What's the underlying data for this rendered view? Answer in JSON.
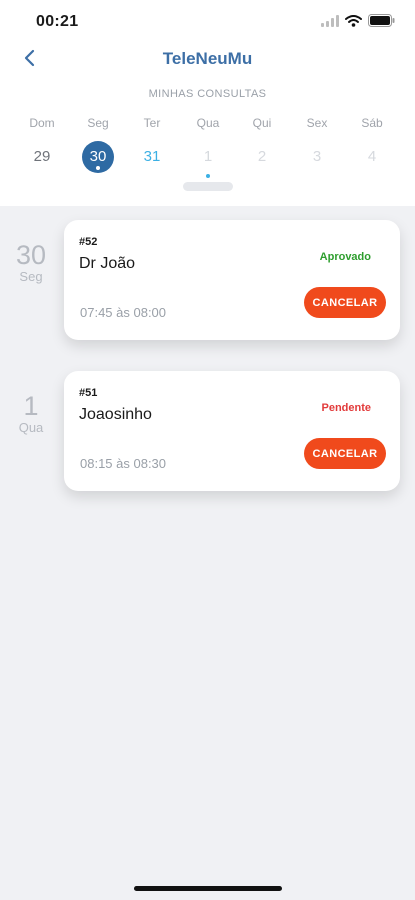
{
  "status_bar": {
    "time": "00:21"
  },
  "header": {
    "title": "TeleNeuMu",
    "subtitle": "MINHAS CONSULTAS"
  },
  "week": [
    {
      "day": "Dom",
      "num": "29"
    },
    {
      "day": "Seg",
      "num": "30"
    },
    {
      "day": "Ter",
      "num": "31"
    },
    {
      "day": "Qua",
      "num": "1"
    },
    {
      "day": "Qui",
      "num": "2"
    },
    {
      "day": "Sex",
      "num": "3"
    },
    {
      "day": "Sáb",
      "num": "4"
    }
  ],
  "appointments": [
    {
      "date_num": "30",
      "date_day": "Seg",
      "code": "#52",
      "name": "Dr João",
      "time": "07:45 às 08:00",
      "status": "Aprovado",
      "status_color": "#2e9e2e",
      "cancel_label": "CANCELAR"
    },
    {
      "date_num": "1",
      "date_day": "Qua",
      "code": "#51",
      "name": "Joaosinho",
      "time": "08:15 às 08:30",
      "status": "Pendente",
      "status_color": "#e23b3b",
      "cancel_label": "CANCELAR"
    }
  ],
  "colors": {
    "accent": "#2e6aa3",
    "cancel": "#f04a1c",
    "title": "#3d6fa6"
  }
}
